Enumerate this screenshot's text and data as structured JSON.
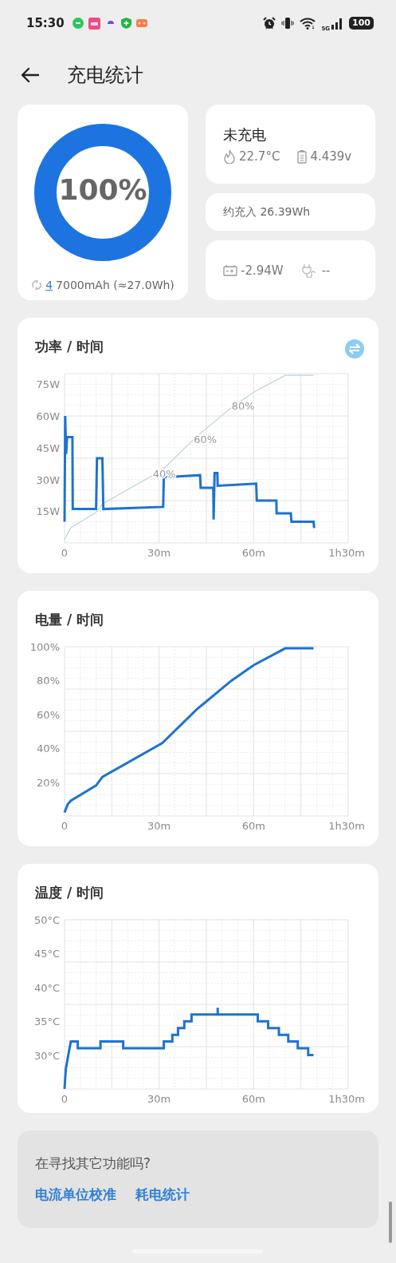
{
  "status_bar": {
    "time": "15:30",
    "network": "5G",
    "battery_level": "100"
  },
  "header": {
    "title": "充电统计"
  },
  "battery_ring": {
    "level": 1,
    "percent": "100%",
    "cycles": "4",
    "capacity": "7000mAh (≈27.0Wh)"
  },
  "status_card": {
    "state": "未充电",
    "temperature": "22.7°C",
    "voltage": "4.439v"
  },
  "energy_card": {
    "text": "约充入 26.39Wh"
  },
  "power_card": {
    "power": "-2.94W",
    "input": "--"
  },
  "charts": [
    {
      "title": "功率 / 时间",
      "toggle": true,
      "chart_data": {
        "type": "line",
        "grid": true,
        "xlim": [
          0,
          90
        ],
        "ylim": [
          0,
          80
        ],
        "xticks": [
          {
            "value": 0,
            "label": "0"
          },
          {
            "value": 30,
            "label": "30m"
          },
          {
            "value": 60,
            "label": "60m"
          },
          {
            "value": 90,
            "label": "1h30m"
          }
        ],
        "yticks": [
          {
            "value": 15,
            "label": "15W"
          },
          {
            "value": 30,
            "label": "30W"
          },
          {
            "value": 45,
            "label": "45W"
          },
          {
            "value": 60,
            "label": "60W"
          },
          {
            "value": 75,
            "label": "75W"
          }
        ],
        "series": [
          {
            "color": "#bcd3de",
            "x": [
              0,
              2,
              10,
              12,
              31,
              42,
              53,
              60,
              70,
              79
            ],
            "values": [
              1.6,
              7.2,
              14.4,
              18.4,
              34.4,
              50.4,
              64,
              71.2,
              79.2,
              79.2
            ]
          },
          {
            "color": "#1e72d2",
            "x": [
              0,
              0.2,
              0.5,
              0.8,
              2.5,
              2.6,
              10,
              10.3,
              12,
              12.3,
              31.3,
              31.5,
              43,
              43.2,
              47.2,
              47.3,
              47.6,
              48.5,
              48.6,
              60.8,
              61,
              67.2,
              67.3,
              71.8,
              72,
              79,
              79.2
            ],
            "values": [
              10,
              60,
              42,
              50,
              50,
              16,
              16,
              40,
              40,
              16,
              17,
              31,
              32,
              26,
              26,
              11,
              33,
              33,
              27,
              28,
              20,
              20,
              14,
              14,
              10,
              10,
              7
            ]
          }
        ],
        "annotations": [
          {
            "text": "40%",
            "x": 28,
            "y": 33
          },
          {
            "text": "60%",
            "x": 41,
            "y": 49
          },
          {
            "text": "80%",
            "x": 53,
            "y": 65
          }
        ]
      }
    },
    {
      "title": "电量 / 时间",
      "chart_data": {
        "type": "line",
        "grid": true,
        "xlim": [
          0,
          90
        ],
        "ylim": [
          0,
          100
        ],
        "xticks": [
          {
            "value": 0,
            "label": "0"
          },
          {
            "value": 30,
            "label": "30m"
          },
          {
            "value": 60,
            "label": "60m"
          },
          {
            "value": 90,
            "label": "1h30m"
          }
        ],
        "yticks": [
          {
            "value": 20,
            "label": "20%"
          },
          {
            "value": 40,
            "label": "40%"
          },
          {
            "value": 60,
            "label": "60%"
          },
          {
            "value": 80,
            "label": "80%"
          },
          {
            "value": 100,
            "label": "100%"
          }
        ],
        "series": [
          {
            "color": "#1e72d2",
            "x": [
              0,
              1,
              2,
              10,
              12,
              31,
              42,
              53,
              60,
              70,
              79
            ],
            "values": [
              2,
              7,
              9,
              18,
              23,
              43,
              63,
              80,
              89,
              99,
              99
            ]
          }
        ]
      }
    },
    {
      "title": "温度 / 时间",
      "chart_data": {
        "type": "line",
        "grid": true,
        "xlim": [
          0,
          90
        ],
        "ylim": [
          25,
          50
        ],
        "xticks": [
          {
            "value": 0,
            "label": "0"
          },
          {
            "value": 30,
            "label": "30m"
          },
          {
            "value": 60,
            "label": "60m"
          },
          {
            "value": 90,
            "label": "1h30m"
          }
        ],
        "yticks": [
          {
            "value": 30,
            "label": "30°C"
          },
          {
            "value": 35,
            "label": "35°C"
          },
          {
            "value": 40,
            "label": "40°C"
          },
          {
            "value": 45,
            "label": "45°C"
          },
          {
            "value": 50,
            "label": "50°C"
          }
        ],
        "series": [
          {
            "color": "#1e72d2",
            "x": [
              0,
              0.4,
              0.8,
              1.2,
              1.6,
              2,
              4.2,
              4.2,
              11.4,
              11.4,
              18.6,
              18.6,
              31.5,
              31.5,
              34.2,
              34.2,
              36,
              36,
              38,
              38,
              40.3,
              40.3,
              48.6,
              48.6,
              48.6,
              61.3,
              61.3,
              64.6,
              64.6,
              68,
              68,
              71,
              71,
              74,
              74,
              77.3,
              77.3,
              79
            ],
            "values": [
              25,
              28,
              29,
              30,
              31,
              32,
              32,
              31,
              31,
              32,
              32,
              31,
              31,
              32,
              32,
              33,
              33,
              34,
              34,
              35,
              35,
              36,
              36,
              37,
              36,
              36,
              35,
              35,
              34,
              34,
              33,
              33,
              32,
              32,
              31,
              31,
              30,
              30
            ]
          }
        ]
      }
    }
  ],
  "more": {
    "question": "在寻找其它功能吗?",
    "links": [
      "电流单位校准",
      "耗电统计"
    ]
  }
}
